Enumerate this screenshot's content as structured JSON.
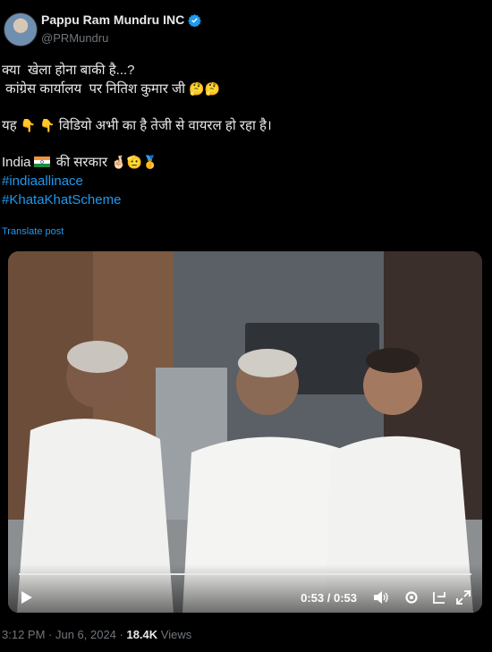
{
  "author": {
    "display_name": "Pappu Ram Mundru INC",
    "handle": "@PRMundru"
  },
  "tweet": {
    "line1": "क्या  खेला होना बाकी है...?",
    "line2": " कांग्रेस कार्यालय  पर नितिश कुमार जी ",
    "line2_emoji": "🤔🤔",
    "line3_a": "यह ",
    "line3_emoji": "👇 👇",
    "line3_b": " विडियो अभी का है तेजी से वायरल हो रहा है।",
    "line4_a": "India",
    "line4_b": " की सरकार ",
    "line4_emoji": "🤞🏻🫡🥇",
    "hashtag1": "#indiaallinace",
    "hashtag2": "#KhataKhatScheme",
    "translate_label": "Translate post"
  },
  "video": {
    "time": "0:53 / 0:53",
    "progress": 1.0
  },
  "meta": {
    "timestamp": "3:12 PM · Jun 6, 2024 · ",
    "views_count": "18.4K",
    "views_label": " Views"
  },
  "colors": {
    "background": "#000000",
    "link": "#1d9bf0",
    "muted": "#71767b",
    "text": "#e7e9ea"
  }
}
